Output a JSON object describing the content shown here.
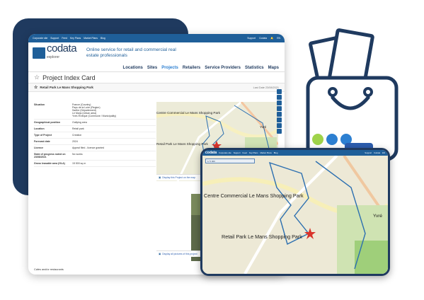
{
  "topbar": {
    "links": [
      "Corporate site",
      "Support",
      "Feed",
      "Key Plans",
      "Market Plans",
      "Blog"
    ],
    "support": "Support",
    "user": "Codata",
    "lang": "EN"
  },
  "brand": {
    "name": "codata",
    "sub": "explorer",
    "tagline": "Online service for retail and commercial real estate professionals"
  },
  "nav": [
    "Locations",
    "Sites",
    "Projects",
    "Retailers",
    "Service Providers",
    "Statistics",
    "Maps"
  ],
  "nav_active": "Projects",
  "page_title": "Project Index Card",
  "project": {
    "name": "Retail Park Le Mans Shopping Park",
    "last_date_label": "Last Date",
    "last_date": "23/08/2021"
  },
  "details": [
    {
      "key": "Situation",
      "lines": [
        "France (Country)",
        "Pays de la Loire (Region)",
        "Sarthe (Département)",
        "Le Mans (Urban area)",
        "Yvré-l'Évêque (Commune / Municipality)"
      ]
    },
    {
      "key": "Geographical position",
      "lines": [
        "Outlying area"
      ]
    },
    {
      "key": "Location",
      "lines": [
        "Retail park"
      ]
    },
    {
      "key": "Type of Project",
      "lines": [
        "Creation"
      ]
    },
    {
      "key": "Forecast date",
      "lines": [
        "2024"
      ]
    },
    {
      "key": "Licence",
      "lines": [
        "Appeal filed - licence granted"
      ]
    },
    {
      "key": "State of progress noted on 23/08/2021",
      "lines": [
        "No works"
      ]
    },
    {
      "key": "Gross leasable area (GLA)",
      "lines": [
        "15 500 sq m"
      ]
    }
  ],
  "map_labels": {
    "commercial": "Centre Commercial Le Mans Shopping Park",
    "retail": "Retail Park Le Mans Shopping Park",
    "yvre": "Yvré"
  },
  "buttons": {
    "display_project": "Display this Project on the map",
    "display_all": "Display all pictures of this project"
  },
  "footer": "Cafes and/or restaurants",
  "popup_scale": "1/ 5 000",
  "colors": {
    "navy": "#1f3a5f",
    "brand_blue": "#1f5f99",
    "accent_red": "#d9332b",
    "green": "#9fd34a",
    "light_blue": "#2c7fd1"
  }
}
